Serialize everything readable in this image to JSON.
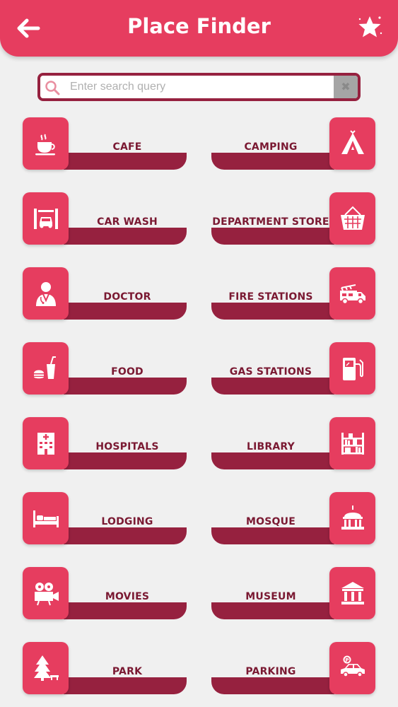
{
  "header": {
    "title": "Place Finder"
  },
  "search": {
    "placeholder": "Enter search query",
    "clear_label": "✖"
  },
  "places": [
    {
      "label": "CAFE",
      "icon": "cafe-icon"
    },
    {
      "label": "CAMPING",
      "icon": "tent-icon"
    },
    {
      "label": "CAR WASH",
      "icon": "car-wash-icon"
    },
    {
      "label": "DEPARTMENT STORE",
      "icon": "basket-icon"
    },
    {
      "label": "DOCTOR",
      "icon": "doctor-icon"
    },
    {
      "label": "FIRE STATIONS",
      "icon": "fire-truck-icon"
    },
    {
      "label": "FOOD",
      "icon": "food-icon"
    },
    {
      "label": "GAS STATIONS",
      "icon": "gas-pump-icon"
    },
    {
      "label": "HOSPITALS",
      "icon": "hospital-icon"
    },
    {
      "label": "LIBRARY",
      "icon": "bookshelf-icon"
    },
    {
      "label": "LODGING",
      "icon": "bed-icon"
    },
    {
      "label": "MOSQUE",
      "icon": "dome-icon"
    },
    {
      "label": "MOVIES",
      "icon": "film-camera-icon"
    },
    {
      "label": "MUSEUM",
      "icon": "museum-icon"
    },
    {
      "label": "PARK",
      "icon": "tree-icon"
    },
    {
      "label": "PARKING",
      "icon": "parking-car-icon"
    }
  ],
  "colors": {
    "primary": "#e63d5f",
    "dark": "#96213f",
    "label": "#7a1932",
    "background": "#f0f0f0"
  }
}
